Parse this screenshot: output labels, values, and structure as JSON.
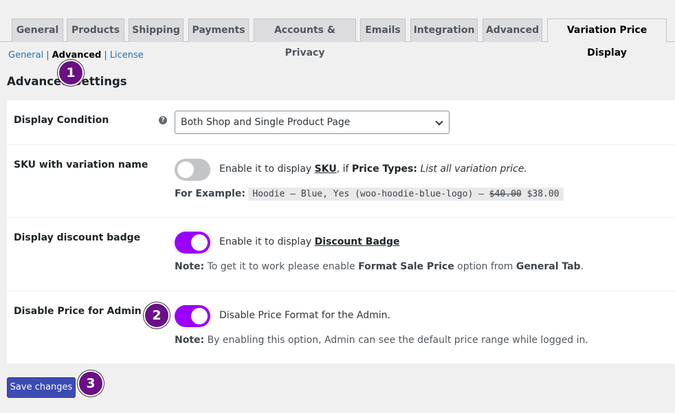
{
  "tabs": [
    {
      "label": "General"
    },
    {
      "label": "Products"
    },
    {
      "label": "Shipping"
    },
    {
      "label": "Payments"
    },
    {
      "label": "Accounts & Privacy"
    },
    {
      "label": "Emails"
    },
    {
      "label": "Integration"
    },
    {
      "label": "Advanced"
    },
    {
      "label": "Variation Price Display"
    }
  ],
  "subnav": {
    "general": "General",
    "advanced": "Advanced",
    "license": "License",
    "sep": "|"
  },
  "section_title": "Advanced Settings",
  "rows": {
    "display_condition": {
      "label": "Display Condition",
      "help": "?",
      "select_value": "Both Shop and Single Product Page"
    },
    "sku": {
      "label": "SKU with variation name",
      "desc_prefix": "Enable it to display ",
      "desc_link": "SKU",
      "desc_mid": ", if ",
      "desc_bold": "Price Types:",
      "desc_italic": "List all variation price.",
      "example_label": "For Example:",
      "example_code": "Hoodie – Blue, Yes (woo-hoodie-blue-logo) – ",
      "example_old_price": "$40.00",
      "example_new_price": "$38.00",
      "enabled": false
    },
    "discount_badge": {
      "label": "Display discount badge",
      "desc_prefix": "Enable it to display ",
      "desc_link": "Discount Badge",
      "note_label": "Note:",
      "note_text1": " To get it to work please enable ",
      "note_bold1": "Format Sale Price",
      "note_text2": " option from ",
      "note_bold2": "General Tab",
      "note_text3": ".",
      "enabled": true
    },
    "disable_admin": {
      "label": "Disable Price for Admin",
      "desc": "Disable Price Format for the Admin.",
      "note_label": "Note:",
      "note_text": " By enabling this option, Admin can see the default price range while logged in.",
      "enabled": true
    }
  },
  "save_label": "Save changes",
  "markers": [
    "1",
    "2",
    "3"
  ],
  "colors": {
    "accent": "#9b00ff",
    "button": "#3c4bb3",
    "marker": "#6b0f86"
  }
}
